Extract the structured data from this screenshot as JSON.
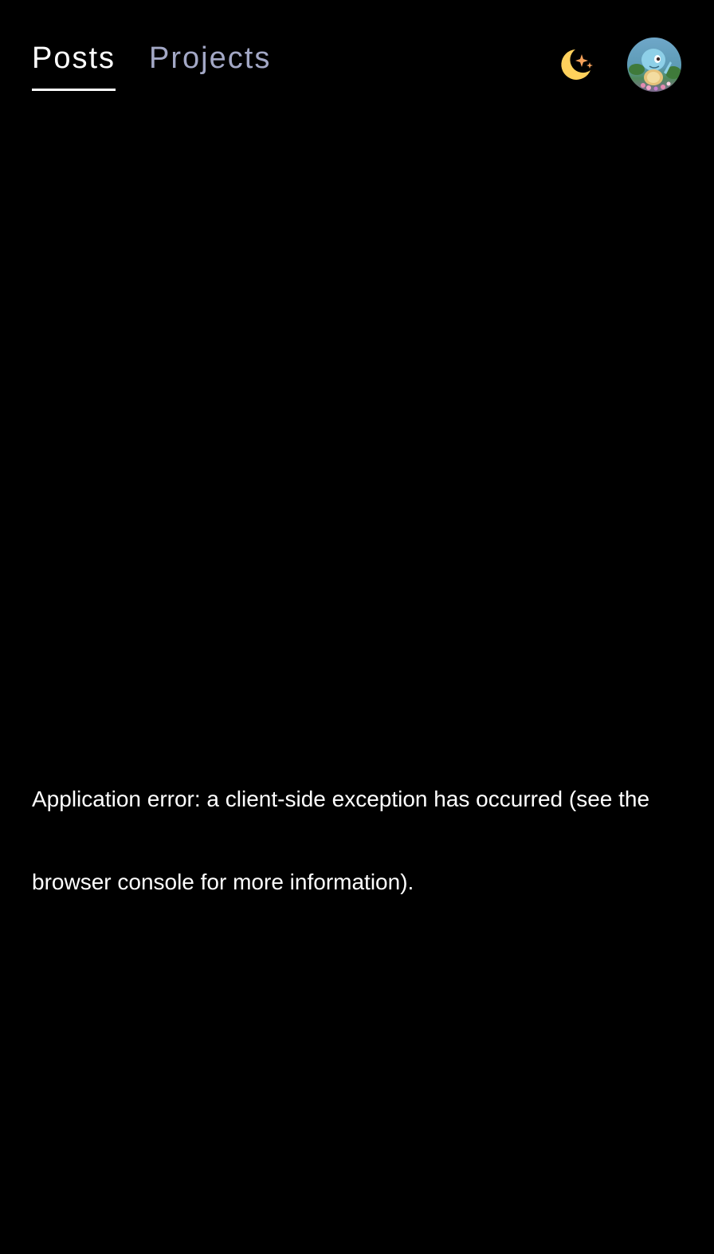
{
  "nav": {
    "tabs": [
      {
        "label": "Posts",
        "active": true
      },
      {
        "label": "Projects",
        "active": false
      }
    ]
  },
  "header": {
    "theme_icon": "moon-sparkle-icon",
    "avatar_icon": "avatar"
  },
  "colors": {
    "background": "#000000",
    "active_tab": "#ffffff",
    "inactive_tab": "#a3a8c6",
    "moon": "#ffd15c",
    "sparkle": "#f5a15a"
  },
  "error": {
    "message": "Application error: a client-side exception has occurred (see the browser console for more information)."
  }
}
